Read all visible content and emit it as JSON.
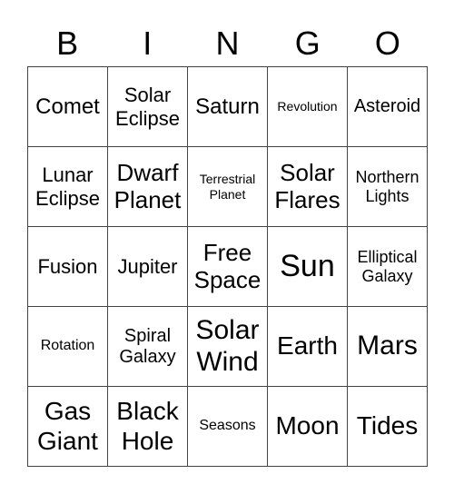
{
  "header": [
    "B",
    "I",
    "N",
    "G",
    "O"
  ],
  "cells": [
    [
      "Comet",
      "Solar Eclipse",
      "Saturn",
      "Revolution",
      "Asteroid"
    ],
    [
      "Lunar Eclipse",
      "Dwarf Planet",
      "Terrestrial Planet",
      "Solar Flares",
      "Northern Lights"
    ],
    [
      "Fusion",
      "Jupiter",
      "Free Space",
      "Sun",
      "Elliptical Galaxy"
    ],
    [
      "Rotation",
      "Spiral Galaxy",
      "Solar Wind",
      "Earth",
      "Mars"
    ],
    [
      "Gas Giant",
      "Black Hole",
      "Seasons",
      "Moon",
      "Tides"
    ]
  ]
}
